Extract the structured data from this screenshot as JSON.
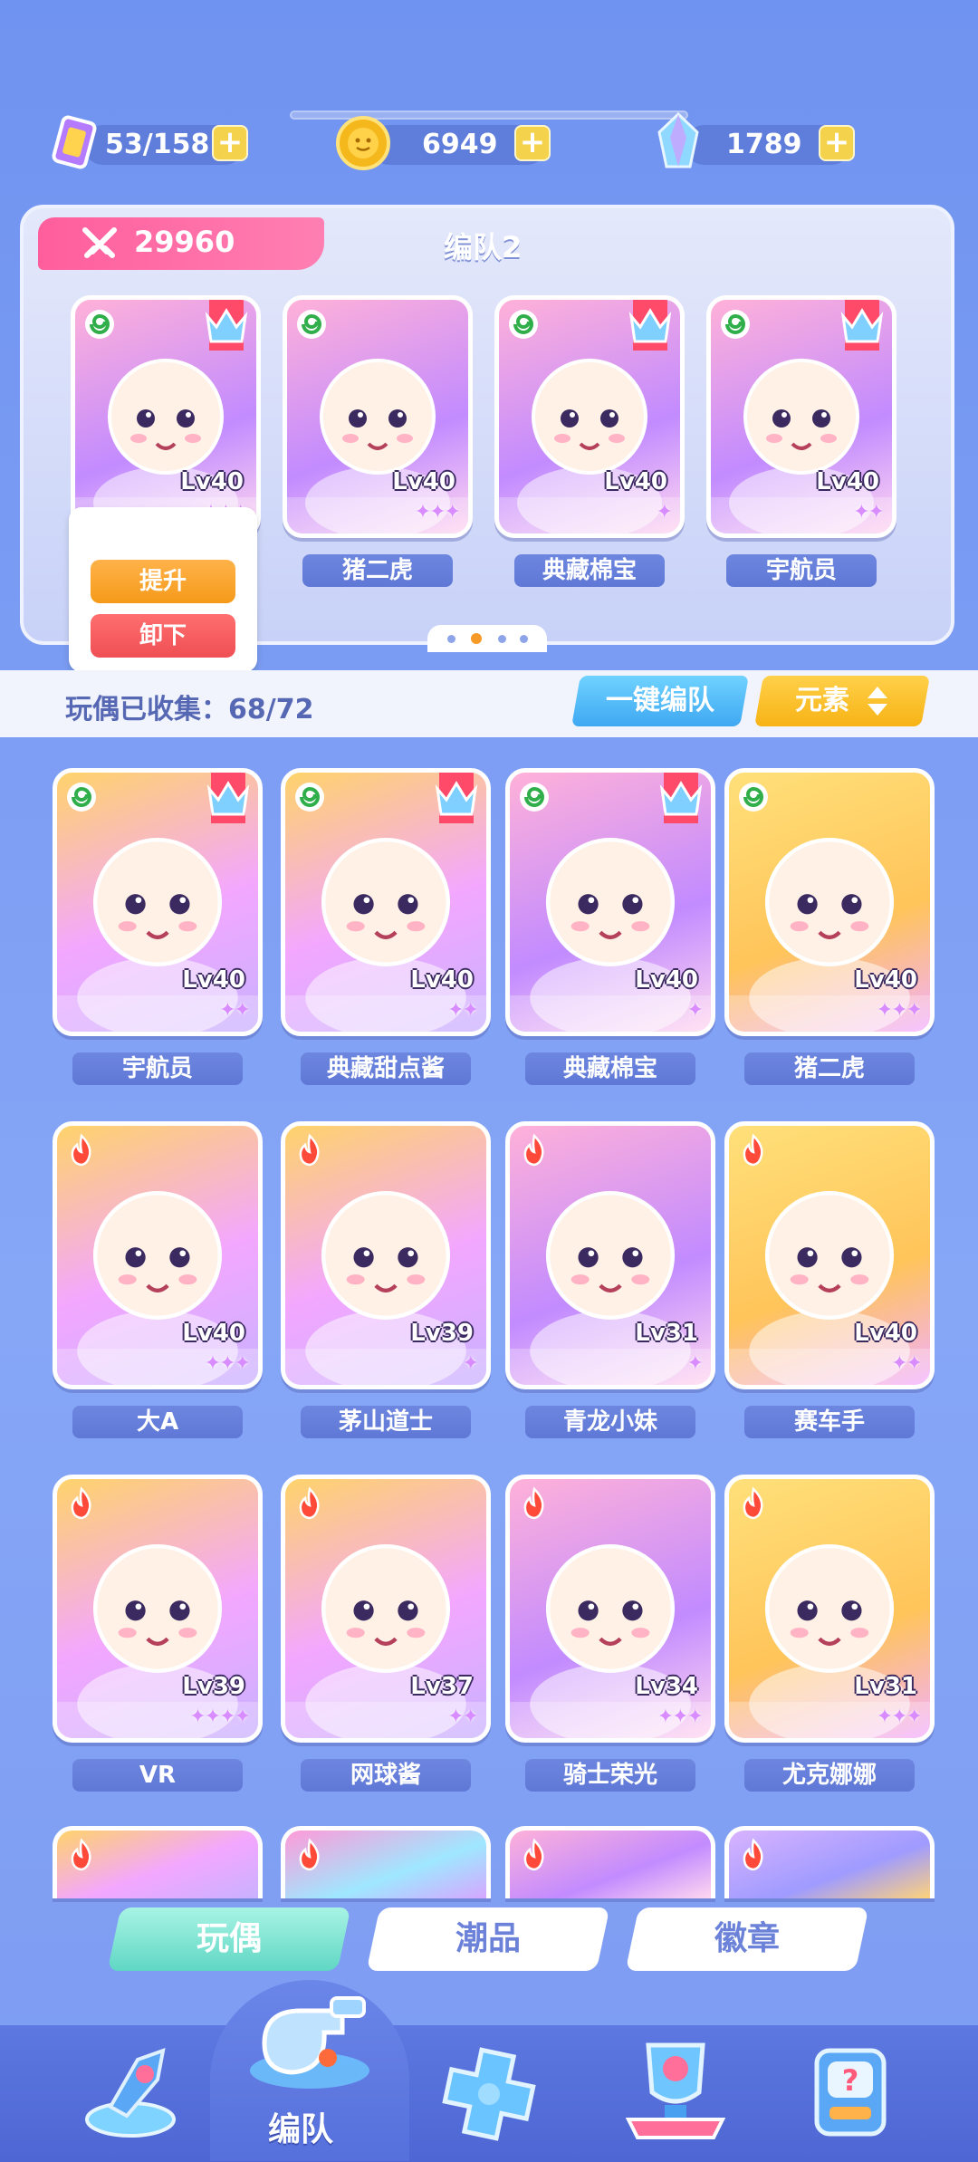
{
  "resources": {
    "energy": "53/158",
    "coins": "6949",
    "crystals": "1789",
    "plus": "+"
  },
  "team": {
    "power": "29960",
    "name": "编队2",
    "members": [
      {
        "name": "",
        "level": "Lv40",
        "stars": "✦✦✦",
        "element": "wind",
        "ce": true
      },
      {
        "name": "猪二虎",
        "level": "Lv40",
        "stars": "✦✦✦",
        "element": "wind",
        "ce": false
      },
      {
        "name": "典藏棉宝",
        "level": "Lv40",
        "stars": "✦",
        "element": "wind",
        "ce": true
      },
      {
        "name": "宇航员",
        "level": "Lv40",
        "stars": "✦✦",
        "element": "wind",
        "ce": true
      }
    ],
    "popup": {
      "upgrade": "提升",
      "unequip": "卸下"
    }
  },
  "collection": {
    "label": "玩偶已收集：68/72",
    "auto_button": "一键编队",
    "element_button": "元素"
  },
  "grid": [
    {
      "name": "宇航员",
      "level": "Lv40",
      "stars": "✦✦",
      "element": "wind",
      "ce": true
    },
    {
      "name": "典藏甜点酱",
      "level": "Lv40",
      "stars": "✦✦",
      "element": "wind",
      "ce": true
    },
    {
      "name": "典藏棉宝",
      "level": "Lv40",
      "stars": "✦",
      "element": "wind",
      "ce": true
    },
    {
      "name": "猪二虎",
      "level": "Lv40",
      "stars": "✦✦✦",
      "element": "wind",
      "ce": false
    },
    {
      "name": "大A",
      "level": "Lv40",
      "stars": "✦✦✦",
      "element": "fire",
      "ce": false
    },
    {
      "name": "茅山道士",
      "level": "Lv39",
      "stars": "✦",
      "element": "fire",
      "ce": false
    },
    {
      "name": "青龙小妹",
      "level": "Lv31",
      "stars": "✦",
      "element": "fire",
      "ce": false
    },
    {
      "name": "赛车手",
      "level": "Lv40",
      "stars": "✦✦",
      "element": "fire",
      "ce": false
    },
    {
      "name": "VR",
      "level": "Lv39",
      "stars": "✦✦✦✦",
      "element": "fire",
      "ce": false
    },
    {
      "name": "网球酱",
      "level": "Lv37",
      "stars": "✦✦",
      "element": "fire",
      "ce": false
    },
    {
      "name": "骑士荣光",
      "level": "Lv34",
      "stars": "✦✦✦",
      "element": "fire",
      "ce": false
    },
    {
      "name": "尤克娜娜",
      "level": "Lv31",
      "stars": "✦✦✦",
      "element": "fire",
      "ce": false
    }
  ],
  "tabs": [
    "玩偶",
    "潮品",
    "徽章"
  ],
  "nav": {
    "active_label": "编队"
  },
  "colors": {
    "fire": "#ff4a3a",
    "wind": "#2fae4a",
    "accent": "#f79a27"
  }
}
